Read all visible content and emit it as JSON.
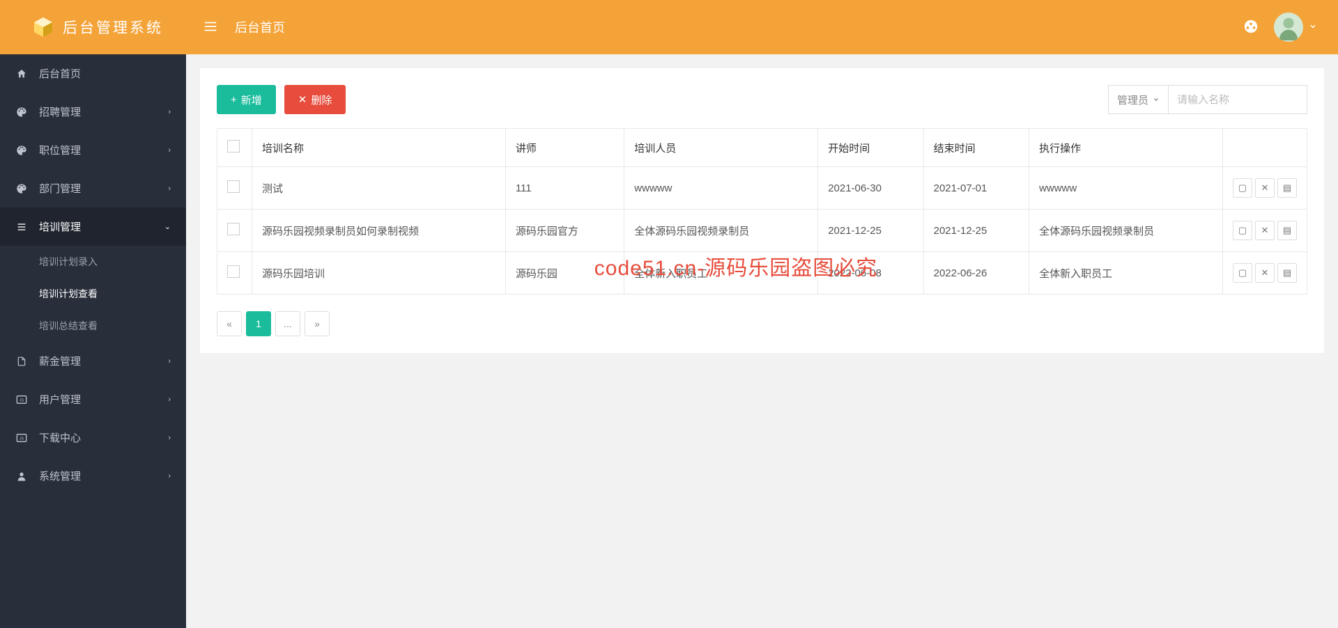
{
  "logo": {
    "text": "后台管理系统"
  },
  "breadcrumb": "后台首页",
  "sidebar": {
    "items": [
      {
        "icon": "home",
        "label": "后台首页",
        "expandable": false
      },
      {
        "icon": "palette",
        "label": "招聘管理",
        "expandable": true
      },
      {
        "icon": "palette",
        "label": "职位管理",
        "expandable": true
      },
      {
        "icon": "palette",
        "label": "部门管理",
        "expandable": true
      },
      {
        "icon": "list",
        "label": "培训管理",
        "expandable": true,
        "expanded": true,
        "children": [
          {
            "label": "培训计划录入"
          },
          {
            "label": "培训计划查看",
            "active": true
          },
          {
            "label": "培训总结查看"
          }
        ]
      },
      {
        "icon": "file",
        "label": "薪金管理",
        "expandable": true
      },
      {
        "icon": "js",
        "label": "用户管理",
        "expandable": true
      },
      {
        "icon": "js",
        "label": "下载中心",
        "expandable": true
      },
      {
        "icon": "user",
        "label": "系统管理",
        "expandable": true
      }
    ]
  },
  "toolbar": {
    "add_label": "新增",
    "delete_label": "删除",
    "filter_select": "管理员",
    "search_placeholder": "请输入名称"
  },
  "table": {
    "headers": [
      "培训名称",
      "讲师",
      "培训人员",
      "开始时间",
      "结束时间",
      "执行操作"
    ],
    "rows": [
      {
        "name": "测试",
        "lecturer": "111",
        "trainees": "wwwww",
        "start": "2021-06-30",
        "end": "2021-07-01",
        "action": "wwwww"
      },
      {
        "name": "源码乐园视频录制员如何录制视频",
        "lecturer": "源码乐园官方",
        "trainees": "全体源码乐园视频录制员",
        "start": "2021-12-25",
        "end": "2021-12-25",
        "action": "全体源码乐园视频录制员"
      },
      {
        "name": "源码乐园培训",
        "lecturer": "源码乐园",
        "trainees": "全体新入职员工",
        "start": "2022-06-08",
        "end": "2022-06-26",
        "action": "全体新入职员工"
      }
    ]
  },
  "pagination": {
    "prev": "«",
    "current": "1",
    "ellipsis": "...",
    "next": "»"
  },
  "watermark": "code51.cn-源码乐园盗图必究"
}
